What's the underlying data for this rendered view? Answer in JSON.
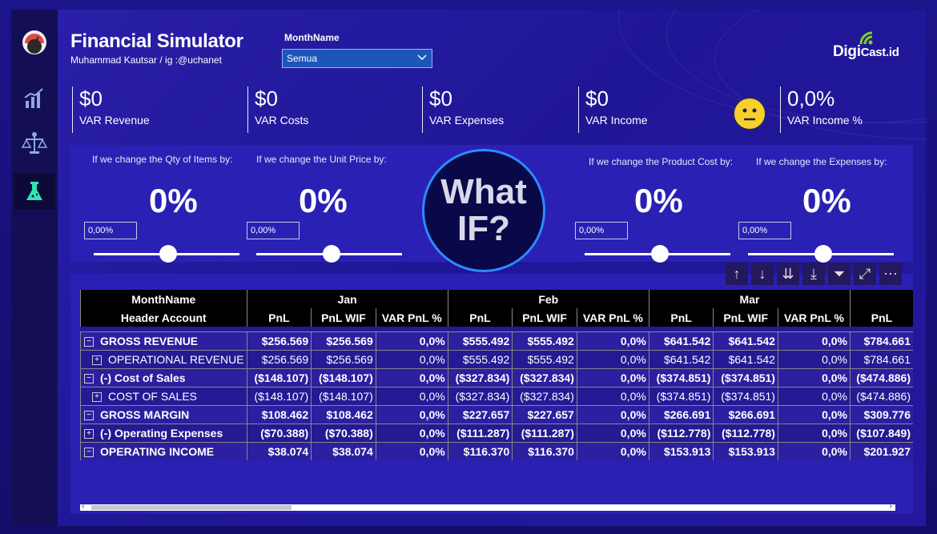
{
  "header": {
    "title": "Financial Simulator",
    "subtitle": "Muhammad  Kautsar / ig :@uchanet",
    "slicer_label": "MonthName",
    "slicer_value": "Semua",
    "logo_prefix": "Digi",
    "logo_suffix": "Cast.id"
  },
  "sidebar": {
    "items": [
      {
        "name": "gauge-icon"
      },
      {
        "name": "bar-chart-icon"
      },
      {
        "name": "scales-icon"
      },
      {
        "name": "flask-icon",
        "active": true
      }
    ]
  },
  "kpis": [
    {
      "value": "$0",
      "label": "VAR Revenue"
    },
    {
      "value": "$0",
      "label": "VAR Costs"
    },
    {
      "value": "$0",
      "label": "VAR Expenses"
    },
    {
      "value": "$0",
      "label": "VAR Income"
    },
    {
      "value": "0,0%",
      "label": "VAR Income %"
    }
  ],
  "whatif": {
    "center_line1": "What",
    "center_line2": "IF?",
    "params": [
      {
        "label": "If we change the Qty of Items by:",
        "big": "0%",
        "input": "0,00%",
        "level": 0.5
      },
      {
        "label": "If we change the Unit Price by:",
        "big": "0%",
        "input": "0,00%",
        "level": 0.5
      },
      {
        "label": "If we change the Product Cost by:",
        "big": "0%",
        "input": "0,00%",
        "level": 0.5
      },
      {
        "label": "If we change the Expenses by:",
        "big": "0%",
        "input": "0,00%",
        "level": 0.5
      }
    ]
  },
  "table": {
    "col_group_header": "MonthName",
    "row_header": "Header Account",
    "months": [
      "Jan",
      "Feb",
      "Mar"
    ],
    "measures": [
      "PnL",
      "PnL WIF",
      "VAR PnL %"
    ],
    "extra_col": "PnL",
    "rows": [
      {
        "icon": "⊟",
        "label": "GROSS REVENUE",
        "bold": true,
        "cells": [
          "$256.569",
          "$256.569",
          "0,0%",
          "$555.492",
          "$555.492",
          "0,0%",
          "$641.542",
          "$641.542",
          "0,0%",
          "$784.661"
        ]
      },
      {
        "icon": "⊞",
        "label": "OPERATIONAL REVENUE",
        "bold": false,
        "indent": true,
        "cells": [
          "$256.569",
          "$256.569",
          "0,0%",
          "$555.492",
          "$555.492",
          "0,0%",
          "$641.542",
          "$641.542",
          "0,0%",
          "$784.661"
        ]
      },
      {
        "icon": "⊟",
        "label": "(-) Cost of Sales",
        "bold": true,
        "cells": [
          "($148.107)",
          "($148.107)",
          "0,0%",
          "($327.834)",
          "($327.834)",
          "0,0%",
          "($374.851)",
          "($374.851)",
          "0,0%",
          "($474.886)"
        ]
      },
      {
        "icon": "⊞",
        "label": "COST OF SALES",
        "bold": false,
        "indent": true,
        "cells": [
          "($148.107)",
          "($148.107)",
          "0,0%",
          "($327.834)",
          "($327.834)",
          "0,0%",
          "($374.851)",
          "($374.851)",
          "0,0%",
          "($474.886)"
        ]
      },
      {
        "icon": "⊟",
        "label": "GROSS MARGIN",
        "bold": true,
        "cells": [
          "$108.462",
          "$108.462",
          "0,0%",
          "$227.657",
          "$227.657",
          "0,0%",
          "$266.691",
          "$266.691",
          "0,0%",
          "$309.776"
        ]
      },
      {
        "icon": "⊞",
        "label": "(-) Operating Expenses",
        "bold": true,
        "cells": [
          "($70.388)",
          "($70.388)",
          "0,0%",
          "($111.287)",
          "($111.287)",
          "0,0%",
          "($112.778)",
          "($112.778)",
          "0,0%",
          "($107.849)"
        ]
      },
      {
        "icon": "⊟",
        "label": "OPERATING INCOME",
        "bold": true,
        "cells": [
          "$38.074",
          "$38.074",
          "0,0%",
          "$116.370",
          "$116.370",
          "0,0%",
          "$153.913",
          "$153.913",
          "0,0%",
          "$201.927"
        ]
      }
    ]
  },
  "toolbar": [
    "arrow-up-icon",
    "arrow-down-icon",
    "double-arrow-down-icon",
    "expand-hierarchy-icon",
    "filter-icon",
    "focus-mode-icon",
    "more-options-icon"
  ]
}
